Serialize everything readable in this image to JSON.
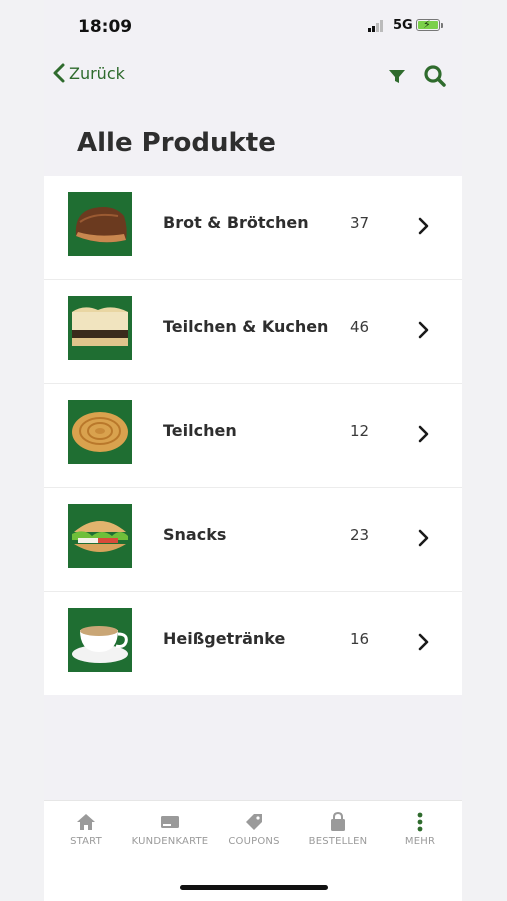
{
  "status_bar": {
    "time": "18:09",
    "network": "5G"
  },
  "navbar": {
    "back_label": "Zurück"
  },
  "page": {
    "title": "Alle Produkte"
  },
  "categories": [
    {
      "label": "Brot & Brötchen",
      "count": "37",
      "image": "bread-loaf"
    },
    {
      "label": "Teilchen & Kuchen",
      "count": "46",
      "image": "cake-slice"
    },
    {
      "label": "Teilchen",
      "count": "12",
      "image": "pastry-swirl"
    },
    {
      "label": "Snacks",
      "count": "23",
      "image": "sandwich"
    },
    {
      "label": "Heißgetränke",
      "count": "16",
      "image": "coffee-cup"
    }
  ],
  "tabbar": {
    "items": [
      {
        "label": "START",
        "icon": "home-icon"
      },
      {
        "label": "KUNDENKARTE",
        "icon": "card-icon"
      },
      {
        "label": "COUPONS",
        "icon": "tag-icon"
      },
      {
        "label": "BESTELLEN",
        "icon": "bag-icon"
      },
      {
        "label": "MEHR",
        "icon": "more-icon"
      }
    ]
  },
  "colors": {
    "accent": "#2f6b2d",
    "thumb_bg": "#1f6e32",
    "tab_inactive": "#9a9a9a"
  }
}
